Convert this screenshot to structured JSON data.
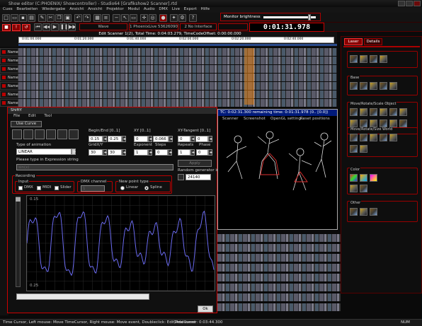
{
  "window": {
    "title": "Show editor (C:PHOENIX/ Showcontroller) - Studio64 [Grafikshow2 Scanner].rtd"
  },
  "menubar": {
    "items": [
      "Cues",
      "Bearbeiten",
      "Wiedergabe",
      "Ansicht",
      "Ansicht",
      "Projektor",
      "Modul",
      "Audio",
      "DMX",
      "Live",
      "Export",
      "Hilfe"
    ]
  },
  "toolbar": {
    "monitor_label": "Monitor brightness",
    "monitor_value": 0.9,
    "wave_label": "Wave",
    "phoenix_label": "1 PhoenixLive 53626090380DC",
    "no_interface_label": "2 No Interface",
    "time": "0:01:31.978"
  },
  "timeline": {
    "caption": "Edit Scanner 1(2), Total Time: 0:04:03.279, TimeCodeOffset: 0:00:00.000",
    "ticks": [
      "0:01:00.000",
      "0:01:20.000",
      "0:01:40.000",
      "0:02:00.000",
      "0:02:20.000",
      "0:02:40.000"
    ],
    "track_label": "Name"
  },
  "right_panel": {
    "tabs": [
      "Laser",
      "Details"
    ],
    "groups": [
      "Base",
      "Move/Rotate/Scale Object",
      "Move/Rotate/Size World",
      "Color",
      "Other"
    ],
    "colors": {
      "border": "#aa0000",
      "active_tab": "#8a0000"
    }
  },
  "shifty": {
    "title": "ShiftY",
    "menu": [
      "File",
      "Edit",
      "Tool"
    ],
    "use_curve": "Use Curve",
    "animation_type_label": "Type of animation",
    "animation_type_value": "LINEAR",
    "expression_label": "Please type in Expression string",
    "expression_value": "sin(x)",
    "begin_end_label": "Begin/End [0..1]",
    "begin_value": "0.15",
    "end_value": "0.25",
    "xy_label": "XY [0..1]",
    "x_value": "0",
    "y_value": "0.066",
    "xy_tangent_label": "XY-Tangent [0..1]",
    "tx_value": "0",
    "ty_value": "0",
    "grid_label": "GridX/Y",
    "grid_x": "30",
    "grid_y": "30",
    "exponent_label": "Exponent",
    "exponent_value": "1",
    "steps_label": "Steps",
    "steps_value": "0",
    "repeats_label": "Repeats",
    "repeats_value": "1",
    "phase_label": "Phase",
    "phase_value": "0",
    "apply_label": "Apply",
    "random_label": "Random generator init",
    "random_value": "24140",
    "recording_label": "Recording",
    "input_label": "Input",
    "dmx_label": "DMX",
    "midi_label": "MIDI",
    "slider_label": "Slider",
    "dmx_channel_label": "DMX channel",
    "dmx_channel_value": "1",
    "new_point_label": "New point type",
    "linear_label": "Linear",
    "spline_label": "Spline",
    "top_value": "0.15",
    "bottom_value": "0.25",
    "ok_label": "Ok"
  },
  "tc_window": {
    "title": "TC: 0:02:31.300 remaining time: 0:01:31.978 (0.. [0.0])",
    "menu": [
      "Scanner",
      "Screenshot",
      "OpenGL setting...",
      "Reset positions"
    ]
  },
  "statusbar": {
    "hint": "Time Cursor, Left mouse: Move TimeCursor, Right mouse: Move event, Doubleclick: Edit/Add event",
    "cursor": "TimeCursor: 0:03:44.300",
    "num": "NUM"
  }
}
